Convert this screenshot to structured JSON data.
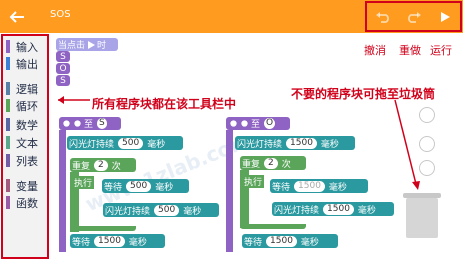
{
  "topbar": {
    "title": "SOS",
    "icons": {
      "back": "back-arrow-icon",
      "undo": "undo-icon",
      "redo": "redo-icon",
      "run": "play-icon"
    },
    "colors": {
      "bar": "#ff9b1e",
      "highlight": "#d0021b"
    }
  },
  "palette": {
    "categories": [
      {
        "label": "输入",
        "color": "#8f63c3"
      },
      {
        "label": "输出",
        "color": "#3d7fd6"
      },
      {
        "label": "逻辑",
        "color": "#5b80a5"
      },
      {
        "label": "循环",
        "color": "#5ba55b"
      },
      {
        "label": "数学",
        "color": "#5b67a5"
      },
      {
        "label": "文本",
        "color": "#5ba58c"
      },
      {
        "label": "列表",
        "color": "#745ba5"
      },
      {
        "label": "变量",
        "color": "#a55b80"
      },
      {
        "label": "函数",
        "color": "#995ba5"
      }
    ]
  },
  "workspace": {
    "hat": {
      "label": "当点击",
      "suffix": "时"
    },
    "s_letters": [
      "S",
      "O",
      "S"
    ],
    "func_left": {
      "header_to": "至",
      "name": "S",
      "flash1": {
        "label": "闪光灯持续",
        "value": "500",
        "unit": "毫秒"
      },
      "repeat": {
        "label": "重复",
        "count": "2",
        "unit": "次"
      },
      "do_label": "执行",
      "wait": {
        "label": "等待",
        "value": "500",
        "unit": "毫秒"
      },
      "flash2": {
        "label": "闪光灯持续",
        "value": "500",
        "unit": "毫秒"
      },
      "wait2": {
        "label": "等待",
        "value": "1500",
        "unit": "毫秒"
      }
    },
    "func_right": {
      "header_to": "至",
      "name": "O",
      "flash1": {
        "label": "闪光灯持续",
        "value": "1500",
        "unit": "毫秒"
      },
      "repeat": {
        "label": "重复",
        "count": "2",
        "unit": "次"
      },
      "do_label": "执行",
      "wait": {
        "label": "等待",
        "value": "1500",
        "unit": "毫秒"
      },
      "flash2": {
        "label": "闪光灯持续",
        "value": "1500",
        "unit": "毫秒"
      },
      "wait2": {
        "label": "等待",
        "value": "1500",
        "unit": "毫秒"
      }
    },
    "watermark": "www.1zlab.com"
  },
  "annotations": {
    "undo": "撤消",
    "redo": "重做",
    "run": "运行",
    "toolbar": "所有程序块都在该工具栏中",
    "trash": "不要的程序块可拖至垃圾筒"
  }
}
